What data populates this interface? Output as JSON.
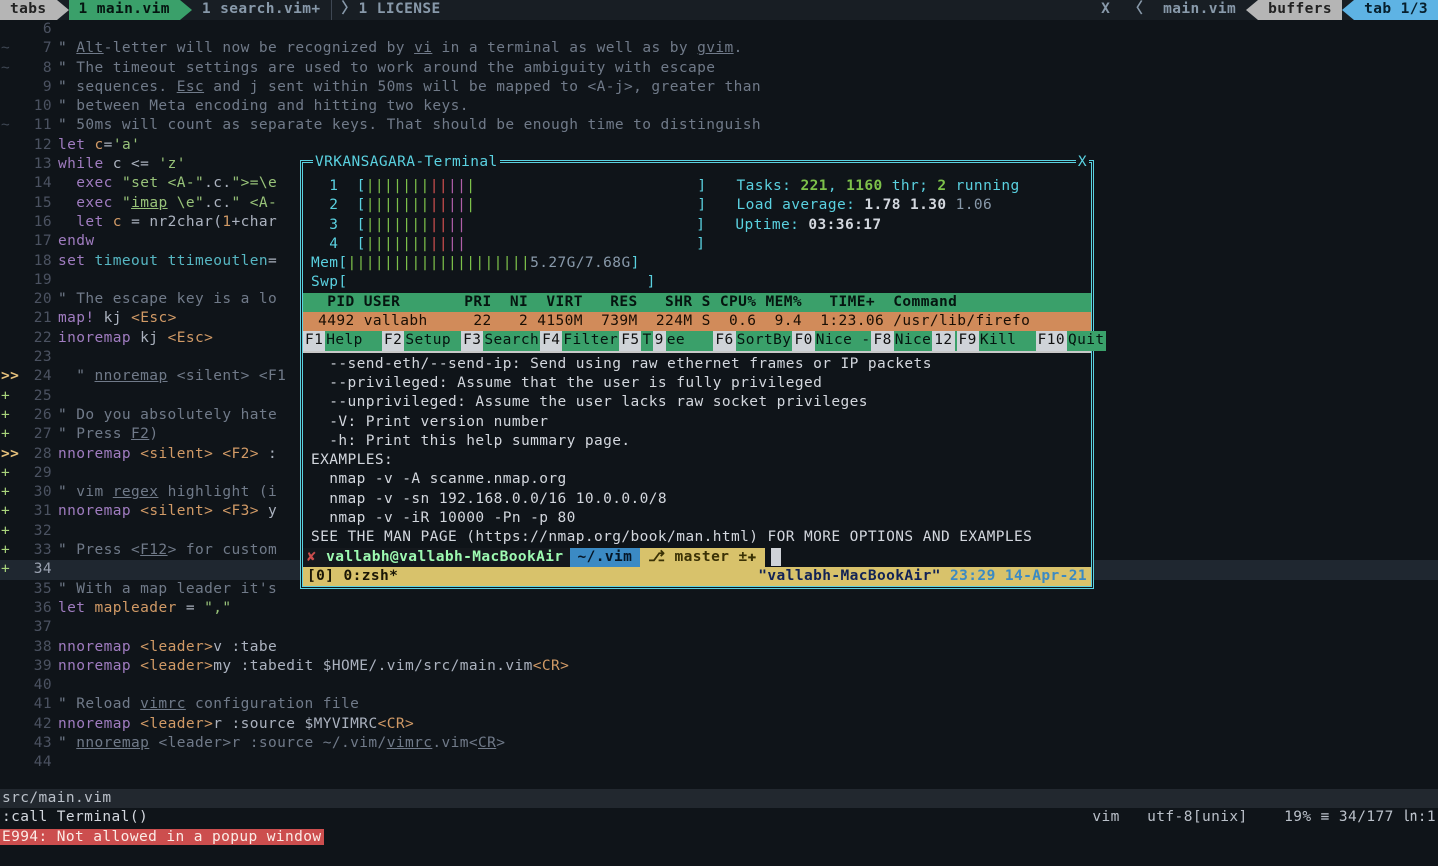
{
  "tabline": {
    "label_tabs": "tabs",
    "tab1": "1 main.vim",
    "tab2": "1 search.vim+",
    "tab3": "1 LICENSE",
    "x": "X",
    "buf_current": "main.vim",
    "label_buffers": "buffers",
    "tab_indicator": "tab 1/3"
  },
  "lines": [
    {
      "n": "6",
      "sign": " ",
      "html": ""
    },
    {
      "n": "7",
      "sign": "~",
      "html": "<span class='c-comment'>\" <span class='c-under'>Alt</span>-letter will now be recognized by <span class='c-under'>vi</span> in a terminal as well as by <span class='c-under'>gvim</span>.</span>"
    },
    {
      "n": "8",
      "sign": "~",
      "html": "<span class='c-comment'>\" The timeout settings are used to work around the ambiguity with escape</span>"
    },
    {
      "n": "9",
      "sign": " ",
      "html": "<span class='c-comment'>\" sequences. <span class='c-under'>Esc</span> and j sent within 50ms will be mapped to &lt;A-j&gt;, greater than</span>"
    },
    {
      "n": "10",
      "sign": " ",
      "html": "<span class='c-comment'>\" between Meta encoding and hitting two keys.</span>"
    },
    {
      "n": "11",
      "sign": "~",
      "html": "<span class='c-comment'>\" 50ms will count as separate keys. That should be enough time to distinguish</span>"
    },
    {
      "n": "12",
      "sign": " ",
      "html": "<span class='c-keyword'>let</span> <span class='c-ident'>c</span>=<span class='c-string'>'a'</span>"
    },
    {
      "n": "13",
      "sign": " ",
      "html": "<span class='c-keyword'>while</span> c &lt;= <span class='c-string'>'z'</span>"
    },
    {
      "n": "14",
      "sign": " ",
      "html": "  <span class='c-keyword'>exec</span> <span class='c-string'>\"set &lt;A-\"</span>.c.<span class='c-string'>\"&gt;=\\e</span>"
    },
    {
      "n": "15",
      "sign": " ",
      "html": "  <span class='c-keyword'>exec</span> <span class='c-string'>\"<span class='c-under'>imap</span> \\e\"</span>.c.<span class='c-string'>\" &lt;A-</span>"
    },
    {
      "n": "16",
      "sign": " ",
      "html": "  <span class='c-keyword'>let</span> <span class='c-ident'>c</span> = nr2char(<span class='c-ident'>1</span>+char"
    },
    {
      "n": "17",
      "sign": " ",
      "html": "<span class='c-keyword'>endw</span>"
    },
    {
      "n": "18",
      "sign": " ",
      "html": "<span class='c-keyword'>set</span> <span class='c-cyan'>timeout</span> <span class='c-cyan'>ttimeoutlen</span>="
    },
    {
      "n": "19",
      "sign": " ",
      "html": ""
    },
    {
      "n": "20",
      "sign": " ",
      "html": "<span class='c-comment'>\" The escape key is a lo</span>"
    },
    {
      "n": "21",
      "sign": " ",
      "html": "<span class='c-keyword'>map!</span> kj <span class='c-ident'>&lt;Esc&gt;</span>"
    },
    {
      "n": "22",
      "sign": " ",
      "html": "<span class='c-keyword'>inoremap</span> kj <span class='c-ident'>&lt;Esc&gt;</span>"
    },
    {
      "n": "23",
      "sign": " ",
      "html": ""
    },
    {
      "n": "24",
      "sign": ">>",
      "html": "  <span class='c-comment'>\" <span class='c-under'>nnoremap</span> &lt;silent&gt; &lt;F1</span>"
    },
    {
      "n": "25",
      "sign": "+",
      "html": ""
    },
    {
      "n": "26",
      "sign": "+",
      "html": "<span class='c-comment'>\" Do you absolutely hate</span>"
    },
    {
      "n": "27",
      "sign": "+",
      "html": "<span class='c-comment'>\" Press <span class='c-under'>F2</span>)</span>"
    },
    {
      "n": "28",
      "sign": ">>",
      "html": "<span class='c-keyword'>nnoremap</span> <span class='c-ident'>&lt;silent&gt;</span> <span class='c-ident'>&lt;F2&gt;</span> :"
    },
    {
      "n": "29",
      "sign": "+",
      "html": ""
    },
    {
      "n": "30",
      "sign": "+",
      "html": "<span class='c-comment'>\" vim <span class='c-under'>regex</span> highlight (i</span>"
    },
    {
      "n": "31",
      "sign": "+",
      "html": "<span class='c-keyword'>nnoremap</span> <span class='c-ident'>&lt;silent&gt;</span> <span class='c-ident'>&lt;F3&gt;</span> y"
    },
    {
      "n": "32",
      "sign": "+",
      "html": ""
    },
    {
      "n": "33",
      "sign": "+",
      "html": "<span class='c-comment'>\" Press &lt;<span class='c-under'>F12</span>&gt; for custom</span>"
    },
    {
      "n": "34",
      "sign": "+",
      "html": "",
      "cl": true
    },
    {
      "n": "35",
      "sign": " ",
      "html": "<span class='c-comment'>\" With a map leader it's</span>"
    },
    {
      "n": "36",
      "sign": " ",
      "html": "<span class='c-keyword'>let</span> <span class='c-ident'>mapleader</span> = <span class='c-string'>\",\"</span>"
    },
    {
      "n": "37",
      "sign": " ",
      "html": ""
    },
    {
      "n": "38",
      "sign": " ",
      "html": "<span class='c-keyword'>nnoremap</span> <span class='c-ident'>&lt;leader&gt;</span>v :tabe"
    },
    {
      "n": "39",
      "sign": " ",
      "html": "<span class='c-keyword'>nnoremap</span> <span class='c-ident'>&lt;leader&gt;</span>my :tabedit $HOME/.vim/src/main.vim<span class='c-ident'>&lt;CR&gt;</span>"
    },
    {
      "n": "40",
      "sign": " ",
      "html": ""
    },
    {
      "n": "41",
      "sign": " ",
      "html": "<span class='c-comment'>\" Reload <span class='c-under'>vimrc</span> configuration file</span>"
    },
    {
      "n": "42",
      "sign": " ",
      "html": "<span class='c-keyword'>nnoremap</span> <span class='c-ident'>&lt;leader&gt;</span>r :source $MYVIMRC<span class='c-ident'>&lt;CR&gt;</span>"
    },
    {
      "n": "43",
      "sign": " ",
      "html": "<span class='c-comment'>\" <span class='c-under'>nnoremap</span> &lt;leader&gt;r :source ~/.vim/<span class='c-under'>vimrc</span>.vim&lt;<span class='c-under'>CR</span>&gt;</span>"
    },
    {
      "n": "44",
      "sign": " ",
      "html": ""
    }
  ],
  "popup": {
    "title": "VRKANSAGARA-Terminal",
    "close": "X",
    "cpu_rows": [
      "1",
      "2",
      "3",
      "4"
    ],
    "mem_label": "Mem",
    "mem_text": "5.27G/7.68G",
    "swp_label": "Swp",
    "tasks_label": "Tasks:",
    "tasks_a": "221",
    "tasks_b": "1160",
    "tasks_thr": "thr;",
    "tasks_run_n": "2",
    "tasks_run": "running",
    "load_label": "Load average:",
    "load1": "1.78",
    "load2": "1.30",
    "load3": "1.06",
    "uptime_label": "Uptime:",
    "uptime": "03:36:17",
    "proc_head": "  PID USER       PRI  NI  VIRT   RES   SHR S CPU% MEM%   TIME+  Command",
    "proc_row": " 4492 vallabh     22   2 4150M  739M  224M S  0.6  9.4  1:23.06 /usr/lib/firefo",
    "fkeys": [
      {
        "k": "F1",
        "l": "Help  "
      },
      {
        "k": "F2",
        "l": "Setup "
      },
      {
        "k": "F3",
        "l": "Search"
      },
      {
        "k": "F4",
        "l": "Filter"
      },
      {
        "k": "F5",
        "l": "T"
      },
      {
        "k": "9",
        "l": "ee   ",
        "sel": true
      },
      {
        "k": "F6",
        "l": "SortBy"
      },
      {
        "k": "F0",
        "l": "Nice -"
      },
      {
        "k": "F8",
        "l": "Nice"
      },
      {
        "k": "12",
        "l": "",
        "sel": true
      },
      {
        "k": "F9",
        "l": "Kill  "
      },
      {
        "k": "F10",
        "l": "Quit"
      }
    ],
    "nmap": [
      "  --send-eth/--send-ip: Send using raw ethernet frames or IP packets",
      "  --privileged: Assume that the user is fully privileged",
      "  --unprivileged: Assume the user lacks raw socket privileges",
      "  -V: Print version number",
      "  -h: Print this help summary page.",
      "EXAMPLES:",
      "  nmap -v -A scanme.nmap.org",
      "  nmap -v -sn 192.168.0.0/16 10.0.0.0/8",
      "  nmap -v -iR 10000 -Pn -p 80",
      "SEE THE MAN PAGE (https://nmap.org/book/man.html) FOR MORE OPTIONS AND EXAMPLES"
    ],
    "prompt_user": "vallabh@vallabh-MacBookAir",
    "prompt_path": "~/.vim",
    "prompt_branch": "master ±✚",
    "tmux_left": "[0] 0:zsh*",
    "tmux_host": "\"vallabh-MacBookAir\"",
    "tmux_time": "23:29 14-Apr-21"
  },
  "status": {
    "file": "src/main.vim",
    "ft": "vim",
    "enc": "utf-8[unix]",
    "pct": "19%",
    "pos": "≡ 34/177 ㏑:1"
  },
  "cmd": ":call Terminal()",
  "err": "E994: Not allowed in a popup window"
}
